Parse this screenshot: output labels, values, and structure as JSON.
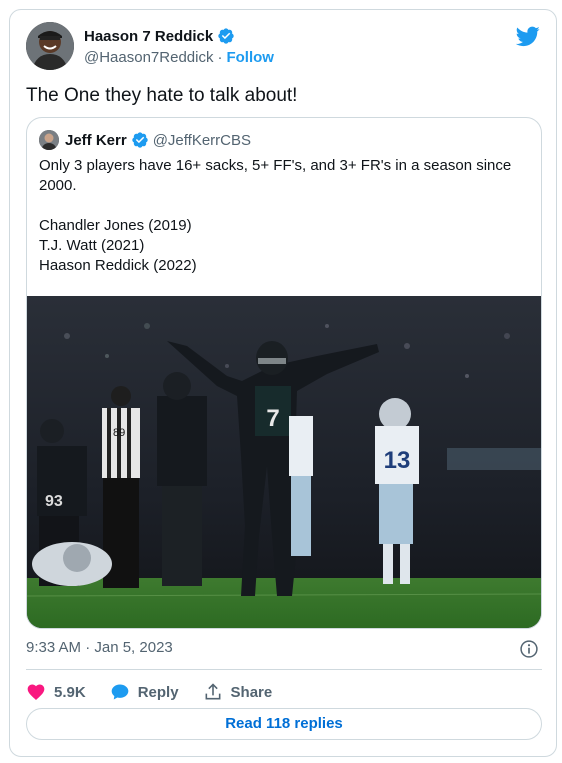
{
  "author": {
    "name": "Haason 7 Reddick",
    "handle": "@Haason7Reddick",
    "separator": "·",
    "follow_label": "Follow"
  },
  "tweet": {
    "text": "The One they hate to talk about!",
    "timestamp": "9:33 AM · Jan 5, 2023"
  },
  "quoted": {
    "name": "Jeff Kerr",
    "handle": "@JeffKerrCBS",
    "lines": [
      "Only 3 players have 16+ sacks, 5+ FF's, and 3+ FR's in a season since",
      "2000.",
      "",
      "Chandler Jones (2019)",
      "T.J. Watt (2021)",
      "Haason Reddick (2022)"
    ],
    "media": {
      "jersey_numbers": [
        "7",
        "89",
        "93",
        "13",
        "7"
      ]
    }
  },
  "actions": {
    "likes": "5.9K",
    "reply_label": "Reply",
    "share_label": "Share"
  },
  "read_replies_label": "Read 118 replies",
  "colors": {
    "accent": "#1d9bf0",
    "like": "#f91880",
    "link": "#006fd6",
    "muted": "#536471",
    "border": "#cfd9de"
  },
  "icons": [
    "verified-badge-icon",
    "twitter-bird-icon",
    "info-icon",
    "heart-icon",
    "reply-bubble-icon",
    "share-icon"
  ]
}
